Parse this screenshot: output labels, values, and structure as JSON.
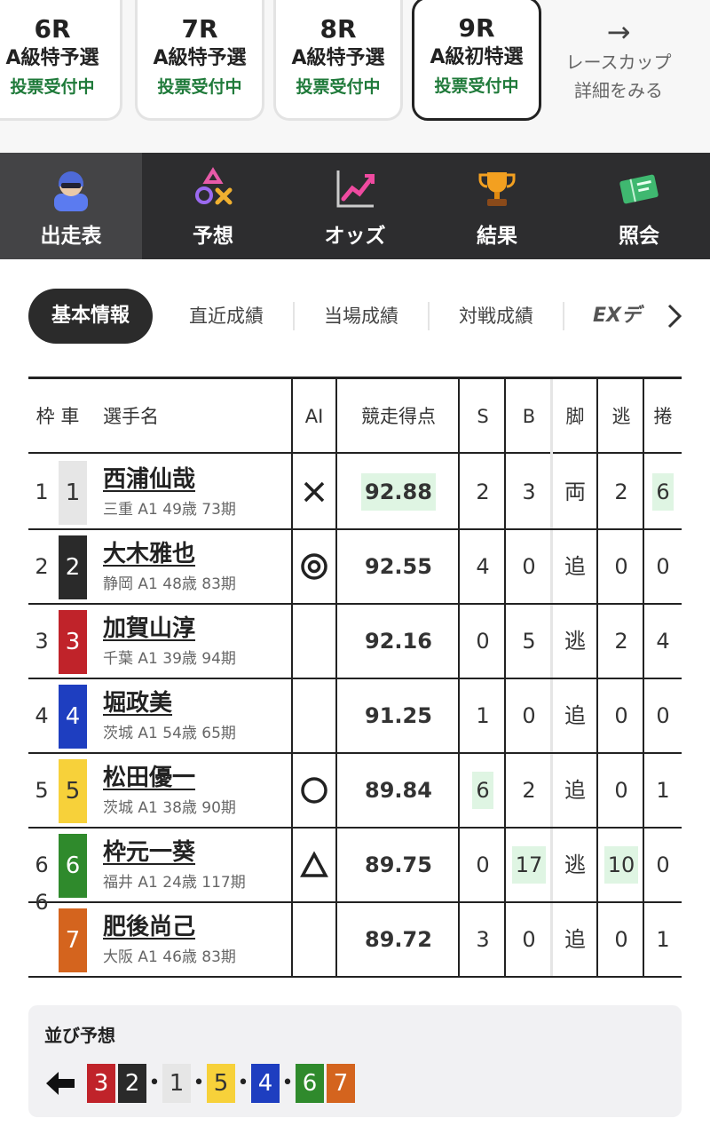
{
  "race_tabs": [
    {
      "no": "6R",
      "cls": "A級特予選",
      "status": "投票受付中"
    },
    {
      "no": "7R",
      "cls": "A級特予選",
      "status": "投票受付中"
    },
    {
      "no": "8R",
      "cls": "A級特予選",
      "status": "投票受付中"
    },
    {
      "no": "9R",
      "cls": "A級初特選",
      "status": "投票受付中"
    }
  ],
  "cup_link": {
    "arrow": "→",
    "line1": "レースカップ",
    "line2": "詳細をみる"
  },
  "nav": [
    {
      "label": "出走表",
      "icon": "rider-helmet-icon"
    },
    {
      "label": "予想",
      "icon": "prediction-marks-icon"
    },
    {
      "label": "オッズ",
      "icon": "odds-chart-icon"
    },
    {
      "label": "結果",
      "icon": "trophy-icon"
    },
    {
      "label": "照会",
      "icon": "ticket-icon"
    }
  ],
  "subtabs": {
    "active": "基本情報",
    "items": [
      "直近成績",
      "当場成績",
      "対戦成績"
    ],
    "ext": "EXデ"
  },
  "table": {
    "headers": {
      "waku_sha": "枠 車",
      "name": "選手名",
      "ai": "AI",
      "score": "競走得点",
      "s": "S",
      "b": "B",
      "kyaku": "脚",
      "nige": "逃",
      "makuri": "捲"
    },
    "rows": [
      {
        "waku": "1",
        "sha": "1",
        "name": "西浦仙哉",
        "info": "三重 A1 49歳 73期",
        "ai": "cross",
        "score": "92.88",
        "s": "2",
        "b": "3",
        "kyaku": "両",
        "nige": "2",
        "makuri": "6"
      },
      {
        "waku": "2",
        "sha": "2",
        "name": "大木雅也",
        "info": "静岡 A1 48歳 83期",
        "ai": "double-circle",
        "score": "92.55",
        "s": "4",
        "b": "0",
        "kyaku": "追",
        "nige": "0",
        "makuri": "0"
      },
      {
        "waku": "3",
        "sha": "3",
        "name": "加賀山淳",
        "info": "千葉 A1 39歳 94期",
        "ai": "",
        "score": "92.16",
        "s": "0",
        "b": "5",
        "kyaku": "逃",
        "nige": "2",
        "makuri": "4"
      },
      {
        "waku": "4",
        "sha": "4",
        "name": "堀政美",
        "info": "茨城 A1 54歳 65期",
        "ai": "",
        "score": "91.25",
        "s": "1",
        "b": "0",
        "kyaku": "追",
        "nige": "0",
        "makuri": "0"
      },
      {
        "waku": "5",
        "sha": "5",
        "name": "松田優一",
        "info": "茨城 A1 38歳 90期",
        "ai": "circle",
        "score": "89.84",
        "s": "6",
        "b": "2",
        "kyaku": "追",
        "nige": "0",
        "makuri": "1"
      },
      {
        "waku": "6",
        "sha": "6",
        "name": "枠元一葵",
        "info": "福井 A1 24歳 117期",
        "ai": "triangle",
        "score": "89.75",
        "s": "0",
        "b": "17",
        "kyaku": "逃",
        "nige": "10",
        "makuri": "0"
      },
      {
        "waku": "",
        "sha": "7",
        "name": "肥後尚己",
        "info": "大阪 A1 46歳 83期",
        "ai": "",
        "score": "89.72",
        "s": "3",
        "b": "0",
        "kyaku": "追",
        "nige": "0",
        "makuri": "1"
      }
    ],
    "waku6_label": "6"
  },
  "frame_colors": {
    "1": "#e6e6e6",
    "2": "#2a2a2a",
    "3": "#c0232a",
    "4": "#1e3ec0",
    "5": "#f7d13a",
    "6": "#2f8a2c",
    "7": "#d4641e"
  },
  "narabi": {
    "title": "並び予想",
    "arrow": "←",
    "groups": [
      [
        "3",
        "2"
      ],
      [
        "1"
      ],
      [
        "5"
      ],
      [
        "4"
      ],
      [
        "6",
        "7"
      ]
    ],
    "dot": "•"
  }
}
